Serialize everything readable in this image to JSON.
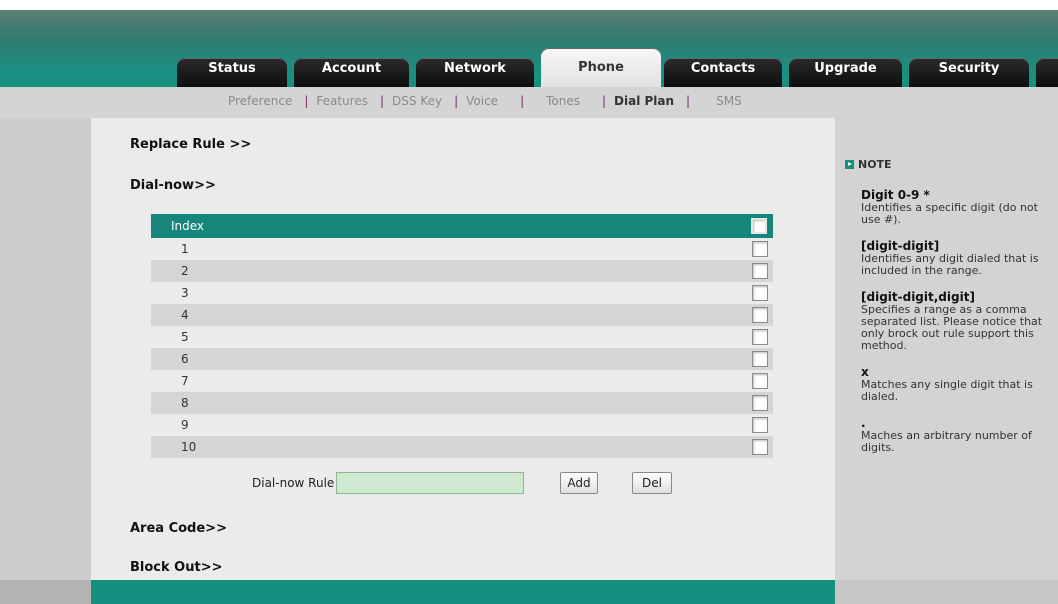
{
  "tabs": [
    "Status",
    "Account",
    "Network",
    "Phone",
    "Contacts",
    "Upgrade",
    "Security"
  ],
  "subnav": [
    "Preference",
    "Features",
    "DSS Key",
    "Voice",
    "Tones",
    "Dial Plan",
    "SMS"
  ],
  "sections": {
    "replace_rule": "Replace Rule >>",
    "dial_now": "Dial-now>>",
    "area_code": "Area Code>>",
    "block_out": "Block Out>>"
  },
  "table": {
    "header": "Index",
    "rows": [
      "1",
      "2",
      "3",
      "4",
      "5",
      "6",
      "7",
      "8",
      "9",
      "10"
    ]
  },
  "rule": {
    "label": "Dial-now Rule",
    "value": "",
    "add_label": "Add",
    "del_label": "Del"
  },
  "note": {
    "title": "NOTE",
    "items": [
      {
        "term": "Digit 0-9 *",
        "desc": "Identifies a specific digit (do not use #)."
      },
      {
        "term": "[digit-digit]",
        "desc": "Identifies any digit dialed that is included in the range."
      },
      {
        "term": "[digit-digit,digit]",
        "desc": "Specifies a range as a comma separated list. Please notice that only brock out rule support this method."
      },
      {
        "term": "x",
        "desc": "Matches any single digit that is dialed."
      },
      {
        "term": ".",
        "desc": "Maches an arbitrary number of digits."
      }
    ]
  },
  "colors": {
    "accent": "#168f7f",
    "input_bg": "#cfe9d0"
  }
}
